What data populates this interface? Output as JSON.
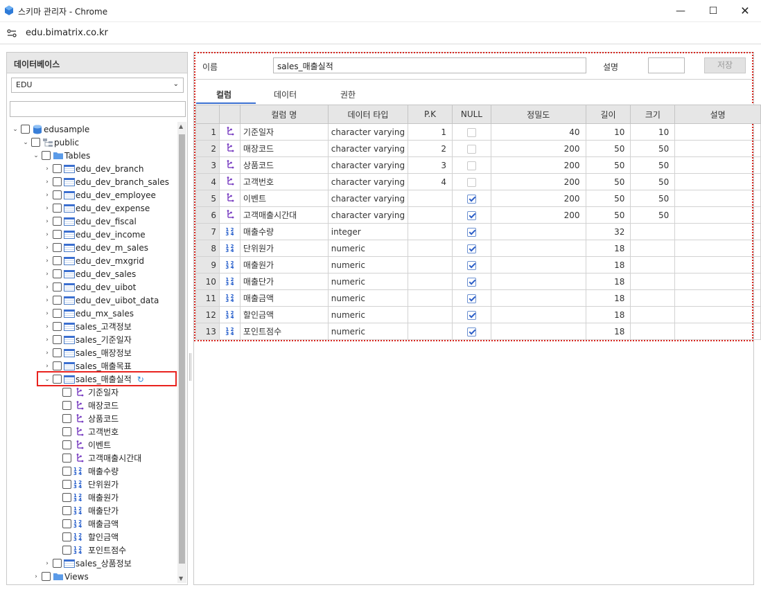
{
  "window": {
    "title": "스키마 관리자 - Chrome",
    "url": "edu.bimatrix.co.kr"
  },
  "left": {
    "header": "데이터베이스",
    "db_selected": "EDU",
    "tree": [
      {
        "label": "edusample",
        "level": 0,
        "icon": "database-icon",
        "toggle": "v"
      },
      {
        "label": "public",
        "level": 1,
        "icon": "schema-icon",
        "toggle": "v"
      },
      {
        "label": "Tables",
        "level": 2,
        "icon": "folder-icon",
        "toggle": "v"
      },
      {
        "label": "edu_dev_branch",
        "level": 3,
        "icon": "table-icon",
        "toggle": ">"
      },
      {
        "label": "edu_dev_branch_sales",
        "level": 3,
        "icon": "table-icon",
        "toggle": ">"
      },
      {
        "label": "edu_dev_employee",
        "level": 3,
        "icon": "table-icon",
        "toggle": ">"
      },
      {
        "label": "edu_dev_expense",
        "level": 3,
        "icon": "table-icon",
        "toggle": ">"
      },
      {
        "label": "edu_dev_fiscal",
        "level": 3,
        "icon": "table-icon",
        "toggle": ">"
      },
      {
        "label": "edu_dev_income",
        "level": 3,
        "icon": "table-icon",
        "toggle": ">"
      },
      {
        "label": "edu_dev_m_sales",
        "level": 3,
        "icon": "table-icon",
        "toggle": ">"
      },
      {
        "label": "edu_dev_mxgrid",
        "level": 3,
        "icon": "table-icon",
        "toggle": ">"
      },
      {
        "label": "edu_dev_sales",
        "level": 3,
        "icon": "table-icon",
        "toggle": ">"
      },
      {
        "label": "edu_dev_uibot",
        "level": 3,
        "icon": "table-icon",
        "toggle": ">"
      },
      {
        "label": "edu_dev_uibot_data",
        "level": 3,
        "icon": "table-icon",
        "toggle": ">"
      },
      {
        "label": "edu_mx_sales",
        "level": 3,
        "icon": "table-icon",
        "toggle": ">"
      },
      {
        "label": "sales_고객정보",
        "level": 3,
        "icon": "table-icon",
        "toggle": ">"
      },
      {
        "label": "sales_기준일자",
        "level": 3,
        "icon": "table-icon",
        "toggle": ">"
      },
      {
        "label": "sales_매장정보",
        "level": 3,
        "icon": "table-icon",
        "toggle": ">"
      },
      {
        "label": "sales_매출목표",
        "level": 3,
        "icon": "table-icon",
        "toggle": ">"
      },
      {
        "label": "sales_매출실적",
        "level": 3,
        "icon": "table-icon",
        "toggle": "v",
        "selected": true
      },
      {
        "label": "기준일자",
        "level": 4,
        "icon": "key-icon",
        "toggle": ""
      },
      {
        "label": "매장코드",
        "level": 4,
        "icon": "key-icon",
        "toggle": ""
      },
      {
        "label": "상품코드",
        "level": 4,
        "icon": "key-icon",
        "toggle": ""
      },
      {
        "label": "고객번호",
        "level": 4,
        "icon": "key-icon",
        "toggle": ""
      },
      {
        "label": "이벤트",
        "level": 4,
        "icon": "key-icon",
        "toggle": ""
      },
      {
        "label": "고객매출시간대",
        "level": 4,
        "icon": "key-icon",
        "toggle": ""
      },
      {
        "label": "매출수량",
        "level": 4,
        "icon": "number-icon",
        "toggle": ""
      },
      {
        "label": "단위원가",
        "level": 4,
        "icon": "number-icon",
        "toggle": ""
      },
      {
        "label": "매출원가",
        "level": 4,
        "icon": "number-icon",
        "toggle": ""
      },
      {
        "label": "매출단가",
        "level": 4,
        "icon": "number-icon",
        "toggle": ""
      },
      {
        "label": "매출금액",
        "level": 4,
        "icon": "number-icon",
        "toggle": ""
      },
      {
        "label": "할인금액",
        "level": 4,
        "icon": "number-icon",
        "toggle": ""
      },
      {
        "label": "포인트점수",
        "level": 4,
        "icon": "number-icon",
        "toggle": ""
      },
      {
        "label": "sales_상품정보",
        "level": 3,
        "icon": "table-icon",
        "toggle": ">"
      },
      {
        "label": "Views",
        "level": 2,
        "icon": "folder-icon",
        "toggle": ">"
      }
    ]
  },
  "right": {
    "name_label": "이름",
    "name_value": "sales_매출실적",
    "desc_label": "설명",
    "save_label": "저장",
    "tabs": [
      "컬럼",
      "데이터",
      "권한"
    ],
    "columns": [
      "",
      "",
      "컬럼 명",
      "데이터 타입",
      "P.K",
      "NULL",
      "정밀도",
      "길이",
      "크기",
      "설명"
    ],
    "rows": [
      {
        "n": "1",
        "icon": "key-icon",
        "name": "기준일자",
        "type": "character varying",
        "pk": "1",
        "null": false,
        "prec": "40",
        "len": "10",
        "size": "10",
        "desc": ""
      },
      {
        "n": "2",
        "icon": "key-icon",
        "name": "매장코드",
        "type": "character varying",
        "pk": "2",
        "null": false,
        "prec": "200",
        "len": "50",
        "size": "50",
        "desc": ""
      },
      {
        "n": "3",
        "icon": "key-icon",
        "name": "상품코드",
        "type": "character varying",
        "pk": "3",
        "null": false,
        "prec": "200",
        "len": "50",
        "size": "50",
        "desc": ""
      },
      {
        "n": "4",
        "icon": "key-icon",
        "name": "고객번호",
        "type": "character varying",
        "pk": "4",
        "null": false,
        "prec": "200",
        "len": "50",
        "size": "50",
        "desc": ""
      },
      {
        "n": "5",
        "icon": "key-icon",
        "name": "이벤트",
        "type": "character varying",
        "pk": "",
        "null": true,
        "prec": "200",
        "len": "50",
        "size": "50",
        "desc": ""
      },
      {
        "n": "6",
        "icon": "key-icon",
        "name": "고객매출시간대",
        "type": "character varying",
        "pk": "",
        "null": true,
        "prec": "200",
        "len": "50",
        "size": "50",
        "desc": ""
      },
      {
        "n": "7",
        "icon": "number-icon",
        "name": "매출수량",
        "type": "integer",
        "pk": "",
        "null": true,
        "prec": "",
        "len": "32",
        "size": "",
        "desc": ""
      },
      {
        "n": "8",
        "icon": "number-icon",
        "name": "단위원가",
        "type": "numeric",
        "pk": "",
        "null": true,
        "prec": "",
        "len": "18",
        "size": "",
        "desc": ""
      },
      {
        "n": "9",
        "icon": "number-icon",
        "name": "매출원가",
        "type": "numeric",
        "pk": "",
        "null": true,
        "prec": "",
        "len": "18",
        "size": "",
        "desc": ""
      },
      {
        "n": "10",
        "icon": "number-icon",
        "name": "매출단가",
        "type": "numeric",
        "pk": "",
        "null": true,
        "prec": "",
        "len": "18",
        "size": "",
        "desc": ""
      },
      {
        "n": "11",
        "icon": "number-icon",
        "name": "매출금액",
        "type": "numeric",
        "pk": "",
        "null": true,
        "prec": "",
        "len": "18",
        "size": "",
        "desc": ""
      },
      {
        "n": "12",
        "icon": "number-icon",
        "name": "할인금액",
        "type": "numeric",
        "pk": "",
        "null": true,
        "prec": "",
        "len": "18",
        "size": "",
        "desc": ""
      },
      {
        "n": "13",
        "icon": "number-icon",
        "name": "포인트점수",
        "type": "numeric",
        "pk": "",
        "null": true,
        "prec": "",
        "len": "18",
        "size": "",
        "desc": ""
      }
    ]
  }
}
